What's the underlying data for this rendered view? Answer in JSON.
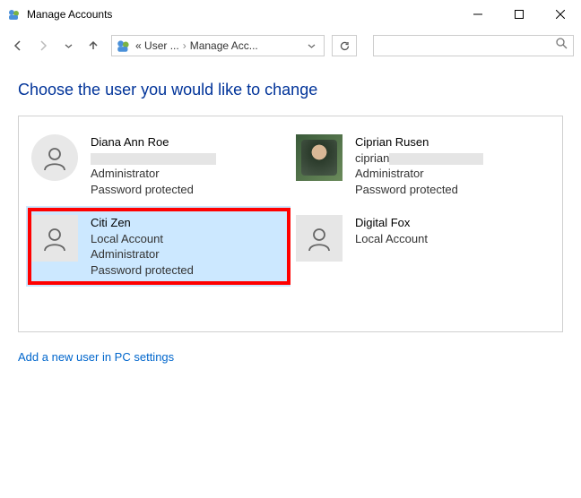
{
  "window": {
    "title": "Manage Accounts"
  },
  "breadcrumb": {
    "prefix": "«",
    "part1": "User ...",
    "part2": "Manage Acc..."
  },
  "heading": "Choose the user you would like to change",
  "accounts": [
    {
      "name": "Diana Ann Roe",
      "type": "",
      "role": "Administrator",
      "protection": "Password protected"
    },
    {
      "name": "Ciprian Rusen",
      "email_prefix": "ciprian",
      "role": "Administrator",
      "protection": "Password protected"
    },
    {
      "name": "Citi Zen",
      "type": "Local Account",
      "role": "Administrator",
      "protection": "Password protected"
    },
    {
      "name": "Digital Fox",
      "type": "Local Account",
      "role": "",
      "protection": ""
    }
  ],
  "link": "Add a new user in PC settings"
}
